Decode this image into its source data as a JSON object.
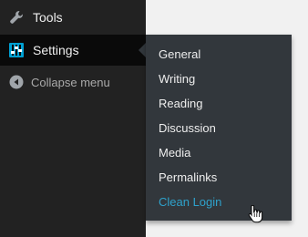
{
  "sidebar": {
    "items": [
      {
        "label": "Tools",
        "icon": "wrench-icon"
      },
      {
        "label": "Settings",
        "icon": "settings-sliders-icon"
      }
    ],
    "collapse_label": "Collapse menu",
    "collapse_icon": "collapse-arrow-icon"
  },
  "submenu": {
    "items": [
      {
        "label": "General"
      },
      {
        "label": "Writing"
      },
      {
        "label": "Reading"
      },
      {
        "label": "Discussion"
      },
      {
        "label": "Media"
      },
      {
        "label": "Permalinks"
      },
      {
        "label": "Clean Login"
      }
    ],
    "hovered_index": 6
  },
  "colors": {
    "sidebar_bg": "#222222",
    "active_bg": "#0a0a0a",
    "submenu_bg": "#32373c",
    "text": "#eeeeee",
    "muted_text": "#aaaaaa",
    "accent": "#2ea2cc",
    "settings_icon_blue": "#00a0d2"
  }
}
